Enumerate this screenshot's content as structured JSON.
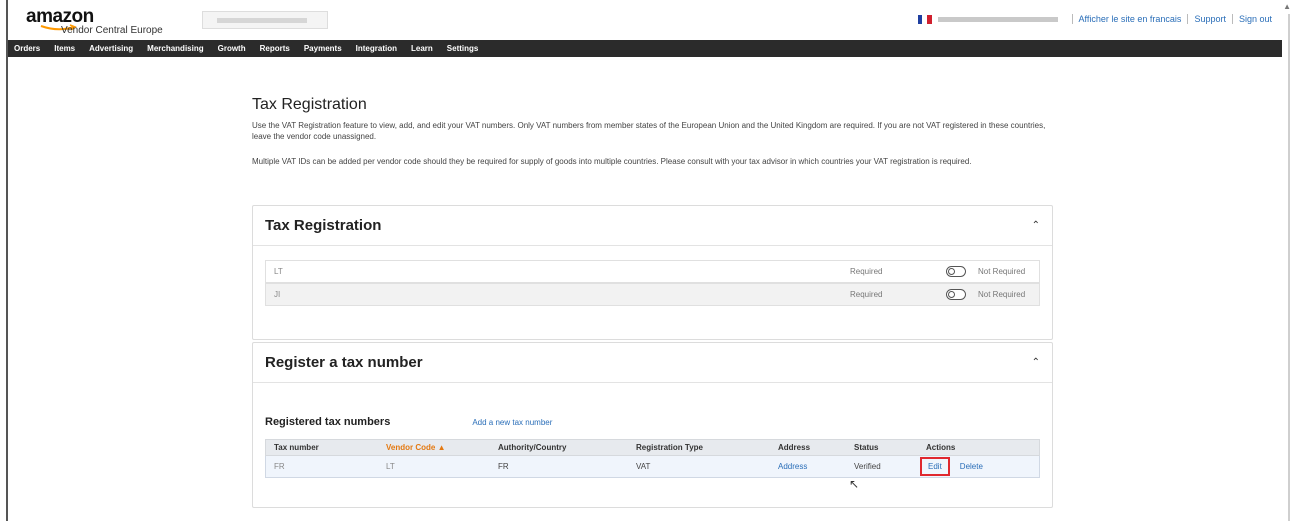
{
  "header": {
    "logo_word": "amazon",
    "logo_sub": "Vendor Central Europe",
    "links": [
      "Afficher le site en francais",
      "Support",
      "Sign out"
    ]
  },
  "nav": [
    "Orders",
    "Items",
    "Advertising",
    "Merchandising",
    "Growth",
    "Reports",
    "Payments",
    "Integration",
    "Learn",
    "Settings"
  ],
  "page": {
    "title": "Tax Registration",
    "intro1": "Use the VAT Registration feature to view, add, and edit your VAT numbers. Only VAT numbers from member states of the European Union and the United Kingdom are required. If you are not VAT registered in these countries, leave the vendor code unassigned.",
    "intro2": "Multiple VAT IDs can be added per vendor code should they be required for supply of goods into multiple countries. Please consult with your tax advisor in which countries your VAT registration is required."
  },
  "tax_registration_card": {
    "title": "Tax Registration",
    "rows": [
      {
        "vendor_code": "LT",
        "required": "Required",
        "not_required": "Not Required"
      },
      {
        "vendor_code": "JI",
        "required": "Required",
        "not_required": "Not Required"
      }
    ]
  },
  "register_card": {
    "title": "Register a tax number",
    "section_title": "Registered tax numbers",
    "add_link": "Add a new tax number",
    "columns": [
      "Tax number",
      "Vendor Code ▲",
      "Authority/Country",
      "Registration Type",
      "Address",
      "Status",
      "Actions"
    ],
    "rows": [
      {
        "tax_number": "FR",
        "vendor_code": "LT",
        "authority": "FR",
        "type": "VAT",
        "address": "Address",
        "status": "Verified",
        "edit": "Edit",
        "delete": "Delete"
      }
    ]
  },
  "colors": {
    "navbar": "#2b2b2b",
    "link": "#2a6eb8",
    "sort_accent": "#e47911",
    "highlight_box": "#e0282e"
  },
  "icons": [
    "chevron-up-icon",
    "toggle-switch",
    "pointer-cursor-icon",
    "fr-flag-icon",
    "smile-arrow-logo"
  ]
}
